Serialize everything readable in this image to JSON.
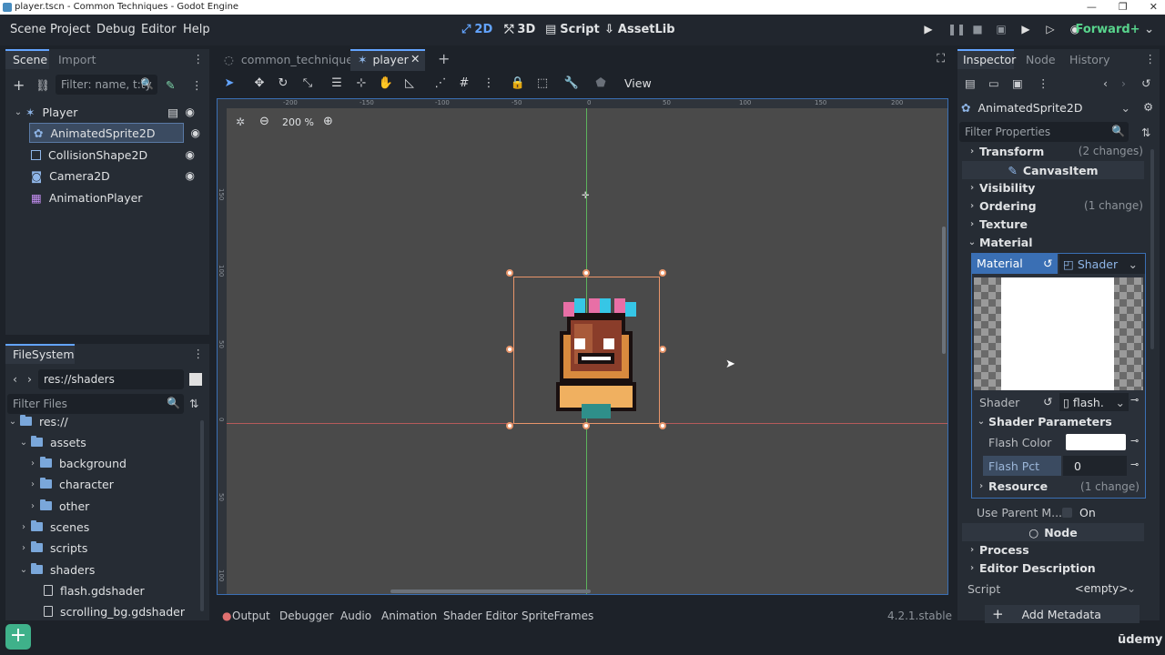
{
  "window": {
    "title": "player.tscn - Common Techniques - Godot Engine"
  },
  "menu": {
    "items": [
      "Scene",
      "Project",
      "Debug",
      "Editor",
      "Help"
    ]
  },
  "workspaces": {
    "btn_2d": "2D",
    "btn_3d": "3D",
    "script": "Script",
    "assetlib": "AssetLib"
  },
  "renderer": "Forward+",
  "scene_dock": {
    "tab_scene": "Scene",
    "tab_import": "Import",
    "filter_placeholder": "Filter: name, t:ty",
    "nodes": [
      {
        "label": "Player"
      },
      {
        "label": "AnimatedSprite2D"
      },
      {
        "label": "CollisionShape2D"
      },
      {
        "label": "Camera2D"
      },
      {
        "label": "AnimationPlayer"
      }
    ]
  },
  "filesystem": {
    "tab": "FileSystem",
    "path": "res://shaders",
    "filter_placeholder": "Filter Files",
    "items": [
      {
        "label": "res://"
      },
      {
        "label": "assets"
      },
      {
        "label": "background"
      },
      {
        "label": "character"
      },
      {
        "label": "other"
      },
      {
        "label": "scenes"
      },
      {
        "label": "scripts"
      },
      {
        "label": "shaders"
      },
      {
        "label": "flash.gdshader"
      },
      {
        "label": "scrolling_bg.gdshader"
      }
    ]
  },
  "editor_tabs": [
    {
      "label": "common_techniques"
    },
    {
      "label": "player"
    }
  ],
  "toolbar": {
    "view": "View"
  },
  "viewport": {
    "zoom": "200 %",
    "ruler_labels": [
      "-200",
      "-150",
      "-100",
      "-50",
      "0",
      "50",
      "100",
      "150",
      "200"
    ],
    "vruler_labels": [
      "150",
      "100",
      "50",
      "0",
      "50",
      "100"
    ]
  },
  "bottom_panel": {
    "tabs": [
      "Output",
      "Debugger",
      "Audio",
      "Animation",
      "Shader Editor",
      "SpriteFrames"
    ],
    "version": "4.2.1.stable"
  },
  "inspector": {
    "tab_inspector": "Inspector",
    "tab_node": "Node",
    "tab_history": "History",
    "object": "AnimatedSprite2D",
    "filter_placeholder": "Filter Properties",
    "sections": {
      "transform": "Transform",
      "transform_changes": "(2 changes)",
      "canvas_item": "CanvasItem",
      "visibility": "Visibility",
      "ordering": "Ordering",
      "ordering_changes": "(1 change)",
      "texture": "Texture",
      "material": "Material"
    },
    "material_prop": {
      "label": "Material",
      "value": "Shader"
    },
    "shader_prop": {
      "label": "Shader",
      "value": "flash."
    },
    "shader_params": {
      "title": "Shader Parameters",
      "flash_color_label": "Flash Color",
      "flash_pct_label": "Flash Pct",
      "flash_pct_value": "0"
    },
    "resource": {
      "label": "Resource",
      "changes": "(1 change)"
    },
    "use_parent": {
      "label": "Use Parent M...",
      "value": "On"
    },
    "node_section": "Node",
    "process": "Process",
    "editor_description": "Editor Description",
    "script": {
      "label": "Script",
      "value": "<empty>"
    },
    "add_metadata": "Add Metadata"
  },
  "watermark": "ūdemy",
  "colors": {
    "accent": "#63a4ff",
    "renderer": "#58d48c",
    "selection": "#3b4b61",
    "viewport": "#4a4a4a",
    "gizmo": "#e8956a"
  }
}
